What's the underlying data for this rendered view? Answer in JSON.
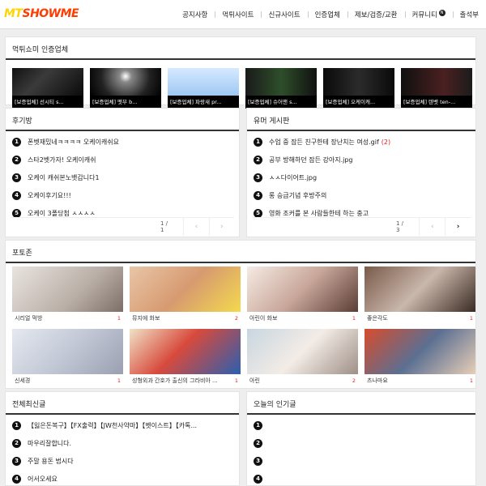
{
  "header": {
    "logo_prefix": "MT",
    "logo_suffix": "SHOWME",
    "nav": [
      "공지사항",
      "먹튀사이트",
      "신규사이트",
      "인증업체",
      "제보/검증/교환",
      "커뮤니티",
      "출석부"
    ],
    "community_badge": "N"
  },
  "cert": {
    "title": "먹튀쇼미 인증업체",
    "items": [
      "[보증업체] 선시티 s...",
      "[보증업체] 멧부 b...",
      "[보증업체] 파랑새 pr...",
      "[보증업체] 슈어맨 s...",
      "[보증업체] 오케이캐...",
      "[보증업체] 텐벳 ten-..."
    ]
  },
  "reviews": {
    "title": "후기방",
    "items": [
      {
        "num": "1",
        "text": "폰벳재밌네ㅋㅋㅋㅋ 오케이캐쉬요"
      },
      {
        "num": "2",
        "text": "스타2벳가자! 오케이캐쉬"
      },
      {
        "num": "3",
        "text": "오케이 캐쉬본노뱃갑니다1"
      },
      {
        "num": "4",
        "text": "오케이후기요!!!"
      },
      {
        "num": "5",
        "text": "오케이 3폴당첨 ㅅㅅㅅㅅ"
      }
    ],
    "page": "1 / 1"
  },
  "humor": {
    "title": "유머 게시판",
    "items": [
      {
        "num": "1",
        "text": "수업 중 잠든 친구한테 장난치는 여성.gif",
        "count": "(2)"
      },
      {
        "num": "2",
        "text": "공부 방해하던 잠든 강아지.jpg",
        "count": ""
      },
      {
        "num": "3",
        "text": "ㅅㅅ다이어트.jpg",
        "count": ""
      },
      {
        "num": "4",
        "text": "롱 승급기념 후방주의",
        "count": ""
      },
      {
        "num": "5",
        "text": "영화 조커를 본 사람들한테 하는 충고",
        "count": ""
      }
    ],
    "page": "1 / 3"
  },
  "photos": {
    "title": "포토존",
    "items": [
      {
        "label": "시리얼 먹방",
        "count": "1"
      },
      {
        "label": "뮤지에 화보",
        "count": "2"
      },
      {
        "label": "아린이 화보",
        "count": "1"
      },
      {
        "label": "좋은각도",
        "count": "1"
      },
      {
        "label": "신세경",
        "count": "1"
      },
      {
        "label": "성형외과 간호가 출신의 그라비아 ...",
        "count": "1"
      },
      {
        "label": "아린",
        "count": "2"
      },
      {
        "label": "츠나마요",
        "count": "1"
      }
    ]
  },
  "latest": {
    "title": "전체최신글",
    "items": [
      {
        "num": "1",
        "text": "【잃은돈복구】【FX출력】【JW천사약마】【벳이스트】【카톡..."
      },
      {
        "num": "2",
        "text": "마우리잘합니다."
      },
      {
        "num": "3",
        "text": "주말 용돈 법시다"
      },
      {
        "num": "4",
        "text": "어서오세요"
      }
    ]
  },
  "popular": {
    "title": "오늘의 인기글",
    "items": [
      {
        "num": "1",
        "text": ""
      },
      {
        "num": "2",
        "text": ""
      },
      {
        "num": "3",
        "text": ""
      },
      {
        "num": "4",
        "text": ""
      }
    ]
  },
  "icons": {
    "prev": "chevron-left-icon",
    "next": "chevron-right-icon"
  },
  "colors": {
    "logo_primary": "#ff3b00",
    "logo_accent": "#ffd400",
    "count_red": "#e02020",
    "rank_badge": "#111111"
  }
}
